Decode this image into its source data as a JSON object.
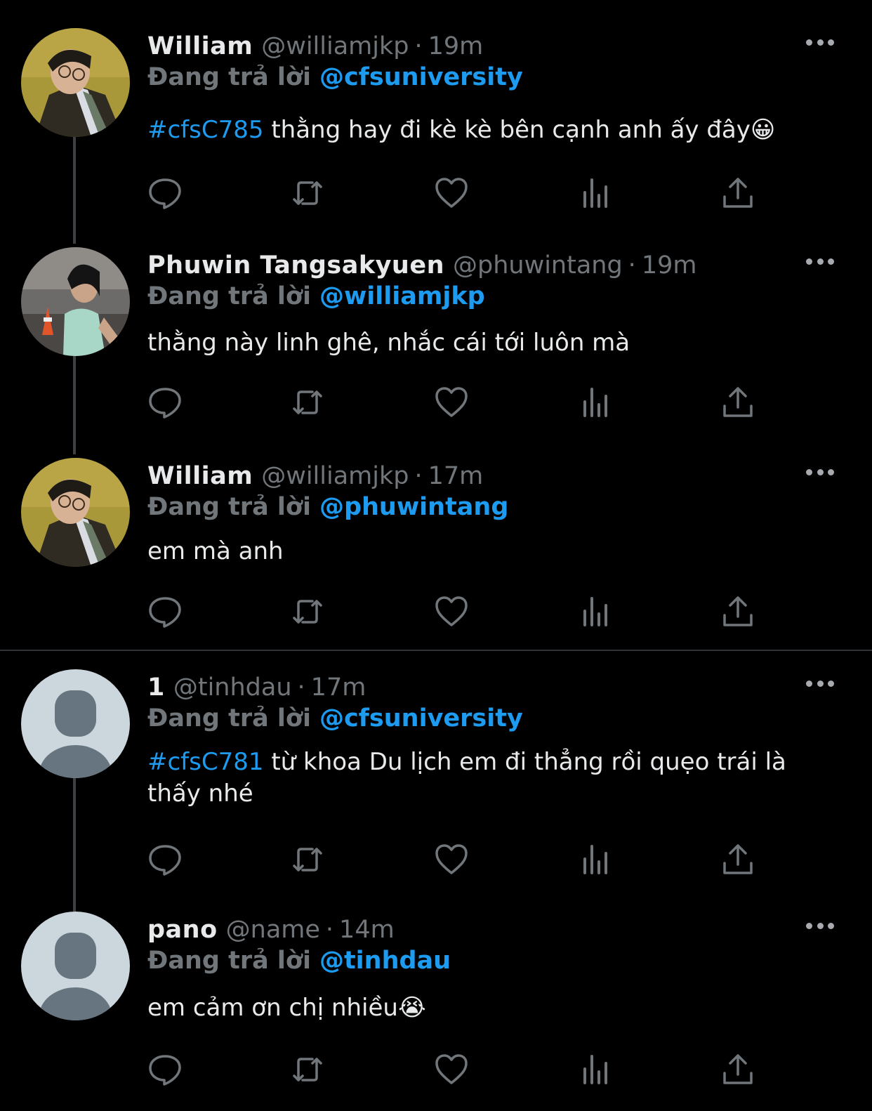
{
  "tweets": [
    {
      "name": "William",
      "handle": "@williamjkp",
      "dot": "·",
      "time": "19m",
      "reply_label": "Đang trả lời",
      "reply_to": "@cfsuniversity",
      "hashtag": "#cfsC785",
      "text": "thằng hay đi kè kè bên cạnh anh ấy đây😀",
      "avatar": "photo-avatar-william"
    },
    {
      "name": "Phuwin Tangsakyuen",
      "handle": "@phuwintang",
      "dot": "·",
      "time": "19m",
      "reply_label": "Đang trả lời",
      "reply_to": "@williamjkp",
      "hashtag": "",
      "text": "thằng này linh ghê, nhắc cái tới luôn mà",
      "avatar": "photo-avatar-phuwin"
    },
    {
      "name": "William",
      "handle": "@williamjkp",
      "dot": "·",
      "time": "17m",
      "reply_label": "Đang trả lời",
      "reply_to": "@phuwintang",
      "hashtag": "",
      "text": "em mà anh",
      "avatar": "photo-avatar-william"
    },
    {
      "name": "1",
      "handle": "@tinhdau",
      "dot": "·",
      "time": "17m",
      "reply_label": "Đang trả lời",
      "reply_to": "@cfsuniversity",
      "hashtag": "#cfsC781",
      "text": "từ khoa Du lịch em đi thẳng rồi quẹo trái là thấy nhé",
      "avatar": "default-avatar"
    },
    {
      "name": "pano",
      "handle": "@name",
      "dot": "·",
      "time": "14m",
      "reply_label": "Đang trả lời",
      "reply_to": "@tinhdau",
      "hashtag": "",
      "text": "em cảm ơn chị nhiều😭",
      "avatar": "default-avatar"
    }
  ],
  "icons": {
    "reply": "speech-bubble-icon",
    "retweet": "retweet-icon",
    "like": "heart-icon",
    "views": "bar-chart-icon",
    "share": "share-upload-icon",
    "more": "more-dots-icon"
  },
  "colors": {
    "background": "#000000",
    "accent": "#1d9bf0",
    "secondary_text": "#71767b",
    "primary_text": "#e7e9ea",
    "thread_line": "#3e4144"
  }
}
